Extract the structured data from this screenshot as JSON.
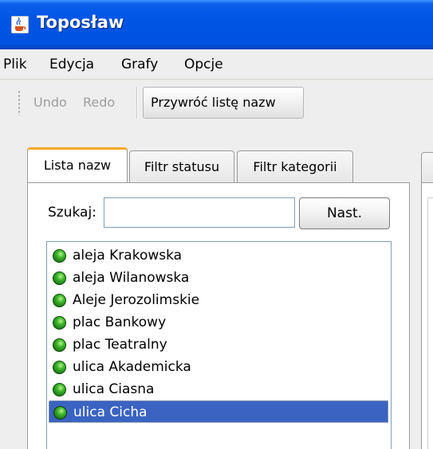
{
  "window": {
    "title": "Toposław"
  },
  "menu": {
    "items": [
      "Plik",
      "Edycja",
      "Grafy",
      "Opcje"
    ]
  },
  "toolbar": {
    "undo_label": "Undo",
    "redo_label": "Redo",
    "restore_label": "Przywróć listę nazw"
  },
  "tabs": [
    "Lista nazw",
    "Filtr statusu",
    "Filtr kategorii"
  ],
  "active_tab": "Lista nazw",
  "search": {
    "label": "Szukaj:",
    "value": "",
    "next_label": "Nast."
  },
  "list": {
    "items": [
      "aleja Krakowska",
      "aleja Wilanowska",
      "Aleje Jerozolimskie",
      "plac Bankowy",
      "plac Teatralny",
      "ulica Akademicka",
      "ulica Ciasna",
      "ulica Cicha"
    ],
    "selected": "ulica Cicha"
  },
  "colors": {
    "title_bar": "#0055e5",
    "active_tab_accent": "#f6a727",
    "selection": "#3a63c2",
    "status_dot": "#3bb52a"
  }
}
